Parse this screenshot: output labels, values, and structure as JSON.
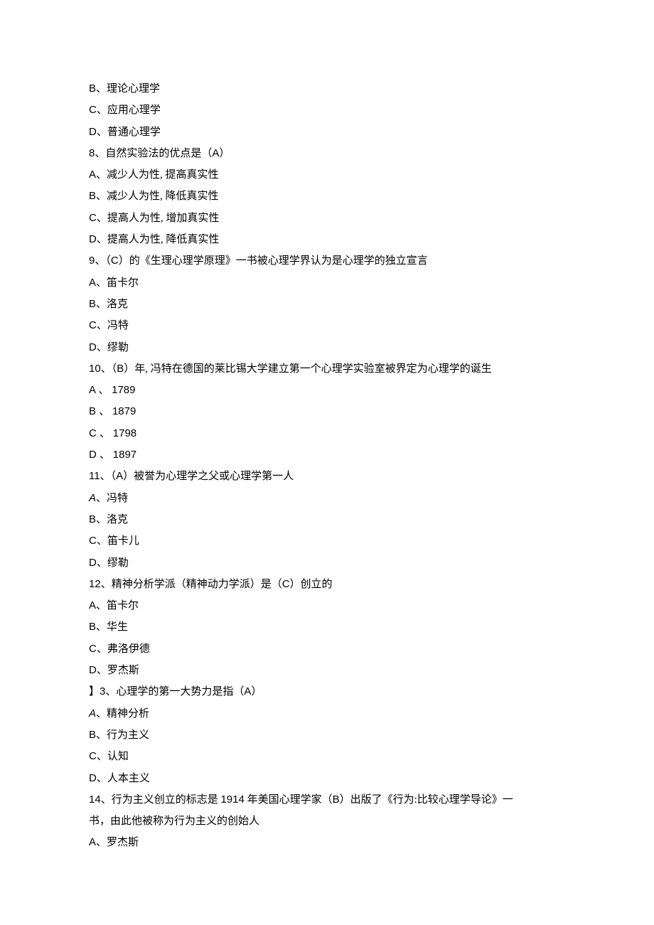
{
  "lines": [
    {
      "segments": [
        {
          "text": "B",
          "cls": "latin"
        },
        {
          "text": "、理论心理学"
        }
      ]
    },
    {
      "segments": [
        {
          "text": "C",
          "cls": "latin"
        },
        {
          "text": "、应用心理学"
        }
      ]
    },
    {
      "segments": [
        {
          "text": "D",
          "cls": "latin"
        },
        {
          "text": "、普通心理学"
        }
      ]
    },
    {
      "segments": [
        {
          "text": "8",
          "cls": "latin"
        },
        {
          "text": "、自然实验法的优点是（"
        },
        {
          "text": "A",
          "cls": "latin"
        },
        {
          "text": "）"
        }
      ]
    },
    {
      "segments": [
        {
          "text": "A",
          "cls": "latin"
        },
        {
          "text": "、减少人为性, 提高真实性"
        }
      ]
    },
    {
      "segments": [
        {
          "text": "B",
          "cls": "latin"
        },
        {
          "text": "、减少人为性, 降低真实性"
        }
      ]
    },
    {
      "segments": [
        {
          "text": "C",
          "cls": "latin"
        },
        {
          "text": "、提高人为性, 增加真实性"
        }
      ]
    },
    {
      "segments": [
        {
          "text": "D",
          "cls": "latin"
        },
        {
          "text": "、提高人为性, 降低真实性"
        }
      ]
    },
    {
      "segments": [
        {
          "text": "9",
          "cls": "latin"
        },
        {
          "text": "、（"
        },
        {
          "text": "C",
          "cls": "latin"
        },
        {
          "text": "）的《生理心理学原理》一书被心理学界认为是心理学的独立宣言"
        }
      ]
    },
    {
      "segments": [
        {
          "text": "A",
          "cls": "latin"
        },
        {
          "text": "、笛卡尔"
        }
      ]
    },
    {
      "segments": [
        {
          "text": "B",
          "cls": "latin"
        },
        {
          "text": "、洛克"
        }
      ]
    },
    {
      "segments": [
        {
          "text": "C",
          "cls": "latin"
        },
        {
          "text": "、冯特"
        }
      ]
    },
    {
      "segments": [
        {
          "text": "D",
          "cls": "latin"
        },
        {
          "text": "、缪勒"
        }
      ]
    },
    {
      "segments": [
        {
          "text": "10",
          "cls": "latin"
        },
        {
          "text": "、（"
        },
        {
          "text": "B",
          "cls": "latin"
        },
        {
          "text": "）年, 冯特在德国的莱比锡大学建立第一个心理学实验室被界定为心理学的诞生"
        }
      ]
    },
    {
      "segments": [
        {
          "text": "A ",
          "cls": "latin"
        },
        {
          "text": "、 "
        },
        {
          "text": "1789",
          "cls": "latin"
        }
      ]
    },
    {
      "segments": [
        {
          "text": "B ",
          "cls": "latin"
        },
        {
          "text": "、 "
        },
        {
          "text": "1879",
          "cls": "latin"
        }
      ]
    },
    {
      "segments": [
        {
          "text": "C ",
          "cls": "latin"
        },
        {
          "text": "、 "
        },
        {
          "text": "1798",
          "cls": "latin"
        }
      ]
    },
    {
      "segments": [
        {
          "text": "D ",
          "cls": "latin"
        },
        {
          "text": "、 "
        },
        {
          "text": "1897",
          "cls": "latin"
        }
      ]
    },
    {
      "segments": [
        {
          "text": "11",
          "cls": "latin"
        },
        {
          "text": "、（"
        },
        {
          "text": "A",
          "cls": "latin"
        },
        {
          "text": "）被誉为心理学之父或心理学第一人"
        }
      ]
    },
    {
      "segments": [
        {
          "text": "A",
          "cls": "latin italic"
        },
        {
          "text": "、冯特"
        }
      ]
    },
    {
      "segments": [
        {
          "text": "B",
          "cls": "latin"
        },
        {
          "text": "、洛克"
        }
      ]
    },
    {
      "segments": [
        {
          "text": "C",
          "cls": "latin"
        },
        {
          "text": "、笛卡儿"
        }
      ]
    },
    {
      "segments": [
        {
          "text": "D",
          "cls": "latin"
        },
        {
          "text": "、缪勒"
        }
      ]
    },
    {
      "segments": [
        {
          "text": "12",
          "cls": "latin"
        },
        {
          "text": "、精神分析学派（精神动力学派）是（"
        },
        {
          "text": "C",
          "cls": "latin"
        },
        {
          "text": "）创立的"
        }
      ]
    },
    {
      "segments": [
        {
          "text": "A",
          "cls": "latin"
        },
        {
          "text": "、笛卡尔"
        }
      ]
    },
    {
      "segments": [
        {
          "text": "B",
          "cls": "latin"
        },
        {
          "text": "、华生"
        }
      ]
    },
    {
      "segments": [
        {
          "text": "C",
          "cls": "latin"
        },
        {
          "text": "、弗洛伊德"
        }
      ]
    },
    {
      "segments": [
        {
          "text": "D",
          "cls": "latin"
        },
        {
          "text": "、罗杰斯"
        }
      ]
    },
    {
      "segments": [
        {
          "text": "】"
        },
        {
          "text": "3",
          "cls": "latin"
        },
        {
          "text": "、心理学的第一大势力是指（"
        },
        {
          "text": "A",
          "cls": "latin"
        },
        {
          "text": "）"
        }
      ]
    },
    {
      "segments": [
        {
          "text": "A",
          "cls": "latin italic"
        },
        {
          "text": "、精神分析"
        }
      ]
    },
    {
      "segments": [
        {
          "text": "B",
          "cls": "latin"
        },
        {
          "text": "、行为主义"
        }
      ]
    },
    {
      "segments": [
        {
          "text": "C",
          "cls": "latin"
        },
        {
          "text": "、认知"
        }
      ]
    },
    {
      "segments": [
        {
          "text": "D",
          "cls": "latin"
        },
        {
          "text": "、人本主义"
        }
      ]
    },
    {
      "segments": [
        {
          "text": "14",
          "cls": "latin"
        },
        {
          "text": "、行为主义创立的标志是 "
        },
        {
          "text": "1914",
          "cls": "latin"
        },
        {
          "text": " 年美国心理学家（"
        },
        {
          "text": "B",
          "cls": "latin"
        },
        {
          "text": "）出版了《行为:比较心理学导论》一"
        }
      ]
    },
    {
      "segments": [
        {
          "text": "书，由此他被称为行为主义的创始人"
        }
      ]
    },
    {
      "segments": [
        {
          "text": "A",
          "cls": "latin"
        },
        {
          "text": "、罗杰斯"
        }
      ]
    }
  ]
}
